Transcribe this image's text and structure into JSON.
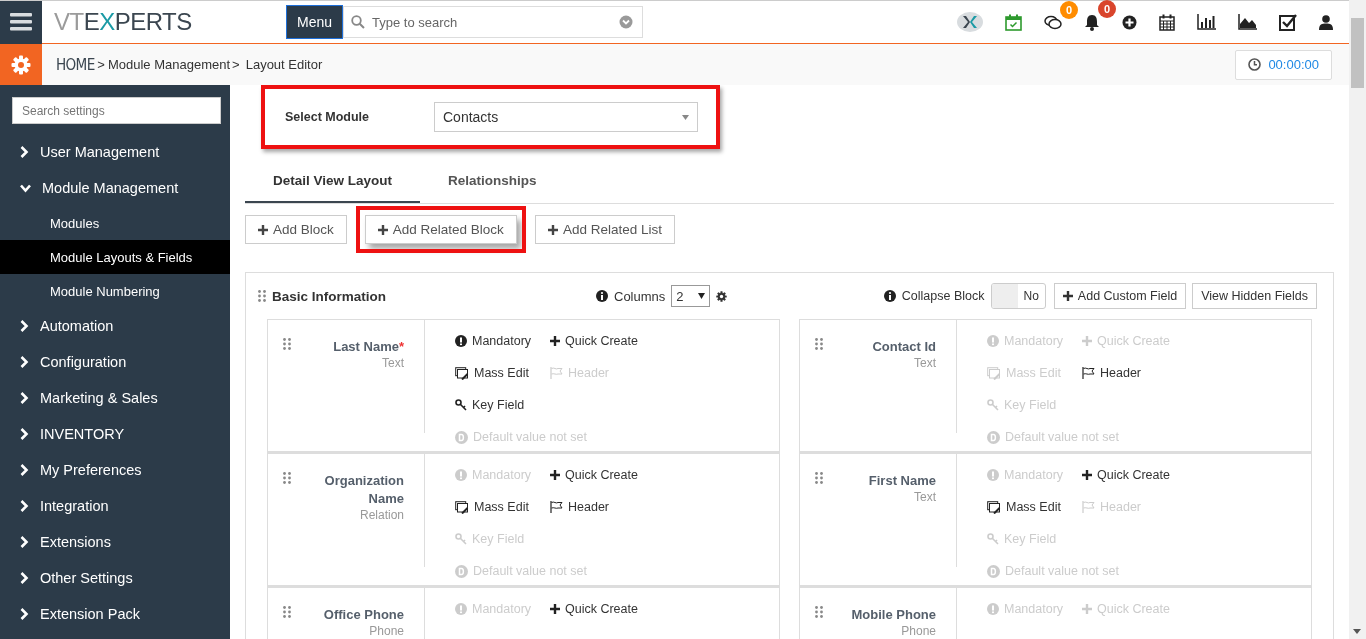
{
  "topbar": {
    "logo": [
      {
        "text": "VT",
        "kind": "light"
      },
      {
        "text": "E",
        "kind": "dark"
      },
      {
        "text": "X",
        "kind": "accent"
      },
      {
        "text": "PERTS",
        "kind": "dark"
      }
    ],
    "menu_button": "Menu",
    "search": {
      "placeholder": "Type to search"
    },
    "chat_badge": "0",
    "notification_badge": "0"
  },
  "breadcrumb": [
    {
      "label": "HOME",
      "kind": "home"
    },
    {
      "label": "Module Management",
      "kind": "link",
      "sep": ">"
    },
    {
      "label": "Layout Editor",
      "kind": "current",
      "sep": ">"
    }
  ],
  "timer": "00:00:00",
  "sidebar": {
    "search": {
      "placeholder": "Search settings"
    },
    "items": [
      {
        "label": "User Management",
        "expanded": false
      },
      {
        "label": "Module Management",
        "expanded": true,
        "children": [
          {
            "label": "Modules",
            "selected": false
          },
          {
            "label": "Module Layouts & Fields",
            "selected": true
          },
          {
            "label": "Module Numbering",
            "selected": false
          }
        ]
      },
      {
        "label": "Automation",
        "expanded": false
      },
      {
        "label": "Configuration",
        "expanded": false
      },
      {
        "label": "Marketing & Sales",
        "expanded": false
      },
      {
        "label": "INVENTORY",
        "expanded": false
      },
      {
        "label": "My Preferences",
        "expanded": false
      },
      {
        "label": "Integration",
        "expanded": false
      },
      {
        "label": "Extensions",
        "expanded": false
      },
      {
        "label": "Other Settings",
        "expanded": false
      },
      {
        "label": "Extension Pack",
        "expanded": false
      }
    ]
  },
  "select_module": {
    "label": "Select Module",
    "value": "Contacts",
    "highlighted": true
  },
  "tabs": [
    {
      "label": "Detail View Layout",
      "selected": true
    },
    {
      "label": "Relationships",
      "selected": false
    }
  ],
  "actions": [
    {
      "label": "Add Block",
      "highlighted": false
    },
    {
      "label": "Add Related Block",
      "highlighted": true
    },
    {
      "label": "Add Related List",
      "highlighted": false
    }
  ],
  "block": {
    "title": "Basic Information",
    "columns_label": "Columns",
    "columns_value": "2",
    "collapse_label": "Collapse Block",
    "collapse_toggle": {
      "on": false,
      "label": "No"
    },
    "buttons": [
      {
        "label": "Add Custom Field",
        "kind": "add"
      },
      {
        "label": "View Hidden Fields",
        "kind": "plain"
      }
    ],
    "field_columns": [
      {
        "fields": [
          {
            "name": "Last Name",
            "required_mark": "*",
            "type": "Text",
            "props": [
              {
                "kind": "mandatory",
                "label": "Mandatory",
                "on": true
              },
              {
                "kind": "quick_create",
                "label": "Quick Create",
                "on": true
              },
              {
                "kind": "mass_edit",
                "label": "Mass Edit",
                "on": true
              },
              {
                "kind": "header",
                "label": "Header",
                "on": false
              },
              {
                "kind": "key_field",
                "label": "Key Field",
                "on": true
              },
              {
                "kind": "default",
                "label": "Default value not set",
                "on": false
              }
            ]
          },
          {
            "name": "Organization Name",
            "type": "Relation",
            "props": [
              {
                "kind": "mandatory",
                "label": "Mandatory",
                "on": false
              },
              {
                "kind": "quick_create",
                "label": "Quick Create",
                "on": true
              },
              {
                "kind": "mass_edit",
                "label": "Mass Edit",
                "on": true
              },
              {
                "kind": "header",
                "label": "Header",
                "on": true
              },
              {
                "kind": "key_field",
                "label": "Key Field",
                "on": false
              },
              {
                "kind": "default",
                "label": "Default value not set",
                "on": false
              }
            ]
          },
          {
            "name": "Office Phone",
            "type": "Phone",
            "props": [
              {
                "kind": "mandatory",
                "label": "Mandatory",
                "on": false
              },
              {
                "kind": "quick_create",
                "label": "Quick Create",
                "on": true
              }
            ]
          }
        ]
      },
      {
        "fields": [
          {
            "name": "Contact Id",
            "type": "Text",
            "props": [
              {
                "kind": "mandatory",
                "label": "Mandatory",
                "on": false
              },
              {
                "kind": "quick_create",
                "label": "Quick Create",
                "on": false
              },
              {
                "kind": "mass_edit",
                "label": "Mass Edit",
                "on": false
              },
              {
                "kind": "header",
                "label": "Header",
                "on": true
              },
              {
                "kind": "key_field",
                "label": "Key Field",
                "on": false
              },
              {
                "kind": "default",
                "label": "Default value not set",
                "on": false
              }
            ]
          },
          {
            "name": "First Name",
            "type": "Text",
            "props": [
              {
                "kind": "mandatory",
                "label": "Mandatory",
                "on": false
              },
              {
                "kind": "quick_create",
                "label": "Quick Create",
                "on": true
              },
              {
                "kind": "mass_edit",
                "label": "Mass Edit",
                "on": true
              },
              {
                "kind": "header",
                "label": "Header",
                "on": false
              },
              {
                "kind": "key_field",
                "label": "Key Field",
                "on": false
              },
              {
                "kind": "default",
                "label": "Default value not set",
                "on": false
              }
            ]
          },
          {
            "name": "Mobile Phone",
            "type": "Phone",
            "props": [
              {
                "kind": "mandatory",
                "label": "Mandatory",
                "on": false
              },
              {
                "kind": "quick_create",
                "label": "Quick Create",
                "on": false
              }
            ]
          }
        ]
      }
    ]
  }
}
